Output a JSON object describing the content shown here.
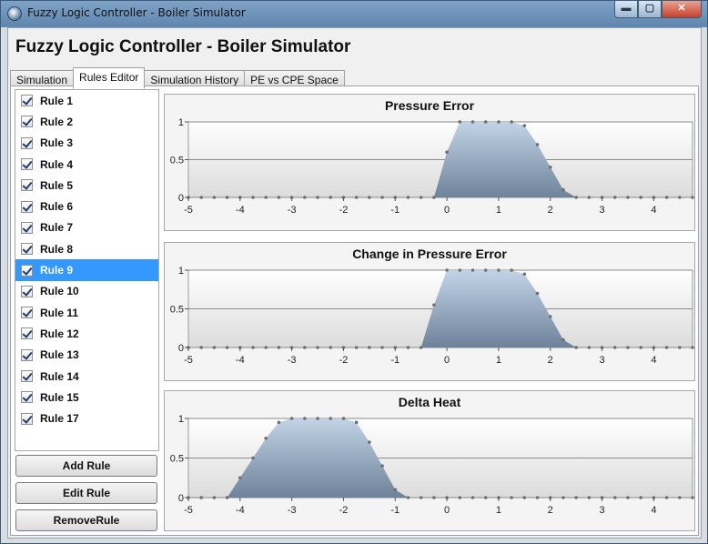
{
  "window": {
    "title": "Fuzzy Logic Controller - Boiler Simulator",
    "controls": {
      "minimize": "▬",
      "maximize": "▢",
      "close": "✕"
    }
  },
  "app_title": "Fuzzy Logic Controller - Boiler Simulator",
  "tabs": [
    {
      "label": "Simulation",
      "active": false
    },
    {
      "label": "Rules Editor",
      "active": true
    },
    {
      "label": "Simulation History",
      "active": false
    },
    {
      "label": "PE vs CPE Space",
      "active": false
    }
  ],
  "rules": [
    {
      "label": "Rule 1",
      "checked": true,
      "selected": false
    },
    {
      "label": "Rule 2",
      "checked": true,
      "selected": false
    },
    {
      "label": "Rule 3",
      "checked": true,
      "selected": false
    },
    {
      "label": "Rule 4",
      "checked": true,
      "selected": false
    },
    {
      "label": "Rule 5",
      "checked": true,
      "selected": false
    },
    {
      "label": "Rule 6",
      "checked": true,
      "selected": false
    },
    {
      "label": "Rule 7",
      "checked": true,
      "selected": false
    },
    {
      "label": "Rule 8",
      "checked": true,
      "selected": false
    },
    {
      "label": "Rule 9",
      "checked": true,
      "selected": true
    },
    {
      "label": "Rule 10",
      "checked": true,
      "selected": false
    },
    {
      "label": "Rule 11",
      "checked": true,
      "selected": false
    },
    {
      "label": "Rule 12",
      "checked": true,
      "selected": false
    },
    {
      "label": "Rule 13",
      "checked": true,
      "selected": false
    },
    {
      "label": "Rule 14",
      "checked": true,
      "selected": false
    },
    {
      "label": "Rule 15",
      "checked": true,
      "selected": false
    },
    {
      "label": "Rule 17",
      "checked": true,
      "selected": false
    }
  ],
  "buttons": {
    "add": "Add Rule",
    "edit": "Edit Rule",
    "remove": "RemoveRule"
  },
  "colors": {
    "selection": "#3399ff",
    "area_top": "#c2d3e6",
    "area_bottom": "#6e839a",
    "marker": "#6f6f6f"
  },
  "chart_data": [
    {
      "type": "area",
      "title": "Pressure Error",
      "xlim": [
        -5,
        4.75
      ],
      "ylim": [
        0,
        1
      ],
      "x_ticks": [
        "-5",
        "-4",
        "-3",
        "-2",
        "-1",
        "0",
        "1",
        "2",
        "3",
        "4"
      ],
      "y_ticks": [
        "0",
        "0.5",
        "1"
      ],
      "x": [
        -5,
        -4.75,
        -4.5,
        -4.25,
        -4,
        -3.75,
        -3.5,
        -3.25,
        -3,
        -2.75,
        -2.5,
        -2.25,
        -2,
        -1.75,
        -1.5,
        -1.25,
        -1,
        -0.75,
        -0.5,
        -0.25,
        0,
        0.25,
        0.5,
        0.75,
        1,
        1.25,
        1.5,
        1.75,
        2,
        2.25,
        2.5,
        2.75,
        3,
        3.25,
        3.5,
        3.75,
        4,
        4.25,
        4.5,
        4.75
      ],
      "y": [
        0,
        0,
        0,
        0,
        0,
        0,
        0,
        0,
        0,
        0,
        0,
        0,
        0,
        0,
        0,
        0,
        0,
        0,
        0,
        0,
        0.6,
        1,
        1,
        1,
        1,
        1,
        0.95,
        0.7,
        0.4,
        0.1,
        0,
        0,
        0,
        0,
        0,
        0,
        0,
        0,
        0,
        0
      ]
    },
    {
      "type": "area",
      "title": "Change in Pressure Error",
      "xlim": [
        -5,
        4.75
      ],
      "ylim": [
        0,
        1
      ],
      "x_ticks": [
        "-5",
        "-4",
        "-3",
        "-2",
        "-1",
        "0",
        "1",
        "2",
        "3",
        "4"
      ],
      "y_ticks": [
        "0",
        "0.5",
        "1"
      ],
      "x": [
        -5,
        -4.75,
        -4.5,
        -4.25,
        -4,
        -3.75,
        -3.5,
        -3.25,
        -3,
        -2.75,
        -2.5,
        -2.25,
        -2,
        -1.75,
        -1.5,
        -1.25,
        -1,
        -0.75,
        -0.5,
        -0.25,
        0,
        0.25,
        0.5,
        0.75,
        1,
        1.25,
        1.5,
        1.75,
        2,
        2.25,
        2.5,
        2.75,
        3,
        3.25,
        3.5,
        3.75,
        4,
        4.25,
        4.5,
        4.75
      ],
      "y": [
        0,
        0,
        0,
        0,
        0,
        0,
        0,
        0,
        0,
        0,
        0,
        0,
        0,
        0,
        0,
        0,
        0,
        0,
        0,
        0.55,
        1,
        1,
        1,
        1,
        1,
        1,
        0.95,
        0.7,
        0.4,
        0.1,
        0,
        0,
        0,
        0,
        0,
        0,
        0,
        0,
        0,
        0
      ]
    },
    {
      "type": "area",
      "title": "Delta Heat",
      "xlim": [
        -5,
        4.75
      ],
      "ylim": [
        0,
        1
      ],
      "x_ticks": [
        "-5",
        "-4",
        "-3",
        "-2",
        "-1",
        "0",
        "1",
        "2",
        "3",
        "4"
      ],
      "y_ticks": [
        "0",
        "0.5",
        "1"
      ],
      "x": [
        -5,
        -4.75,
        -4.5,
        -4.25,
        -4,
        -3.75,
        -3.5,
        -3.25,
        -3,
        -2.75,
        -2.5,
        -2.25,
        -2,
        -1.75,
        -1.5,
        -1.25,
        -1,
        -0.75,
        -0.5,
        -0.25,
        0,
        0.25,
        0.5,
        0.75,
        1,
        1.25,
        1.5,
        1.75,
        2,
        2.25,
        2.5,
        2.75,
        3,
        3.25,
        3.5,
        3.75,
        4,
        4.25,
        4.5,
        4.75
      ],
      "y": [
        0,
        0,
        0,
        0,
        0.25,
        0.5,
        0.75,
        0.95,
        1,
        1,
        1,
        1,
        1,
        0.95,
        0.7,
        0.4,
        0.1,
        0,
        0,
        0,
        0,
        0,
        0,
        0,
        0,
        0,
        0,
        0,
        0,
        0,
        0,
        0,
        0,
        0,
        0,
        0,
        0,
        0,
        0,
        0
      ]
    }
  ]
}
